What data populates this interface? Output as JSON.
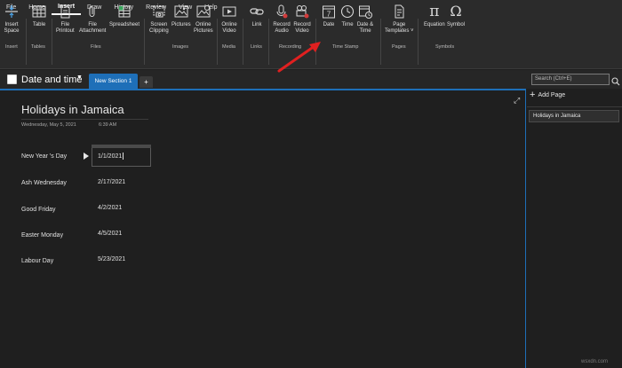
{
  "menubar": {
    "items": [
      "File",
      "Home",
      "Insert",
      "Draw",
      "History",
      "Review",
      "View",
      "Help"
    ],
    "active": "Insert"
  },
  "ribbon": {
    "buttons": {
      "insert_space": "Insert\nSpace",
      "table": "Table",
      "file_printout": "File\nPrintout",
      "file_attachment": "File\nAttachment",
      "spreadsheet": "Spreadsheet",
      "screen_clipping": "Screen\nClipping",
      "pictures": "Pictures",
      "online_pictures": "Online\nPictures",
      "online_video": "Online\nVideo",
      "link": "Link",
      "record_audio": "Record\nAudio",
      "record_video": "Record\nVideo",
      "date": "Date",
      "time": "Time",
      "date_time": "Date &\nTime",
      "page_templates": "Page\nTemplates ˅",
      "equation": "Equation",
      "symbol": "Symbol"
    },
    "groups": {
      "insert": "Insert",
      "tables": "Tables",
      "files": "Files",
      "images": "Images",
      "media": "Media",
      "links": "Links",
      "recording": "Recording",
      "time_stamp": "Time Stamp",
      "pages": "Pages",
      "symbols": "Symbols"
    }
  },
  "notebook": {
    "name": "Date and time",
    "section_tab": "New Section 1",
    "add_tab": "+",
    "search_placeholder": "Search (Ctrl+E)"
  },
  "page": {
    "title": "Holidays in Jamaica",
    "date": "Wednesday, May 5, 2021",
    "time": "6:39 AM",
    "rows": [
      {
        "label": "New Year 's Day",
        "value": "1/1/2021"
      },
      {
        "label": "Ash Wednesday",
        "value": "2/17/2021"
      },
      {
        "label": "Good Friday",
        "value": "4/2/2021"
      },
      {
        "label": "Easter Monday",
        "value": "4/5/2021"
      },
      {
        "label": "Labour Day",
        "value": "5/23/2021"
      }
    ]
  },
  "right_panel": {
    "add_page": "Add Page",
    "pages": [
      "Holidays in Jamaica"
    ]
  },
  "watermark": "wsxdn.com",
  "colors": {
    "accent": "#1e6fb8",
    "annotation": "#e02020",
    "record": "#d23b3b",
    "background": "#1f1f1f",
    "ribbon": "#2b2b2b"
  }
}
